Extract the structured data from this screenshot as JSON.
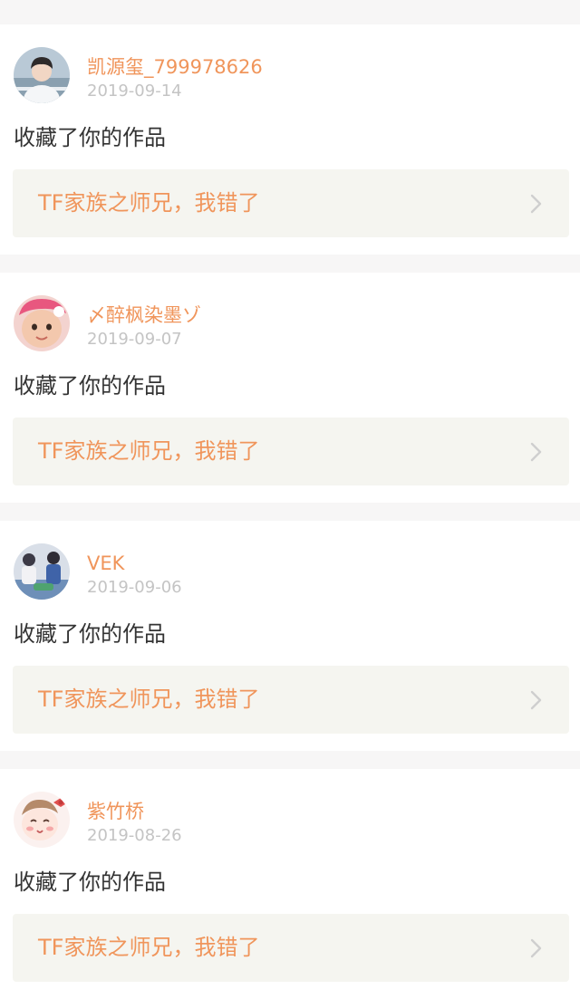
{
  "colors": {
    "accent": "#f0955b",
    "date": "#c4c4c4",
    "text": "#333333",
    "card_bg": "#ffffff",
    "page_bg": "#f7f6f6",
    "link_bg": "#f5f5f0",
    "chevron": "#cfcfcf"
  },
  "icons": {
    "chevron": "chevron-right-icon"
  },
  "notifications": [
    {
      "user_name": "凯源玺_799978626",
      "date": "2019-09-14",
      "action": "收藏了你的作品",
      "work_title": "TF家族之师兄，我错了"
    },
    {
      "user_name": "〆醉枫染墨ゾ",
      "date": "2019-09-07",
      "action": "收藏了你的作品",
      "work_title": "TF家族之师兄，我错了"
    },
    {
      "user_name": "VEK",
      "date": "2019-09-06",
      "action": "收藏了你的作品",
      "work_title": "TF家族之师兄，我错了"
    },
    {
      "user_name": "紫竹桥",
      "date": "2019-08-26",
      "action": "收藏了你的作品",
      "work_title": "TF家族之师兄，我错了"
    }
  ]
}
